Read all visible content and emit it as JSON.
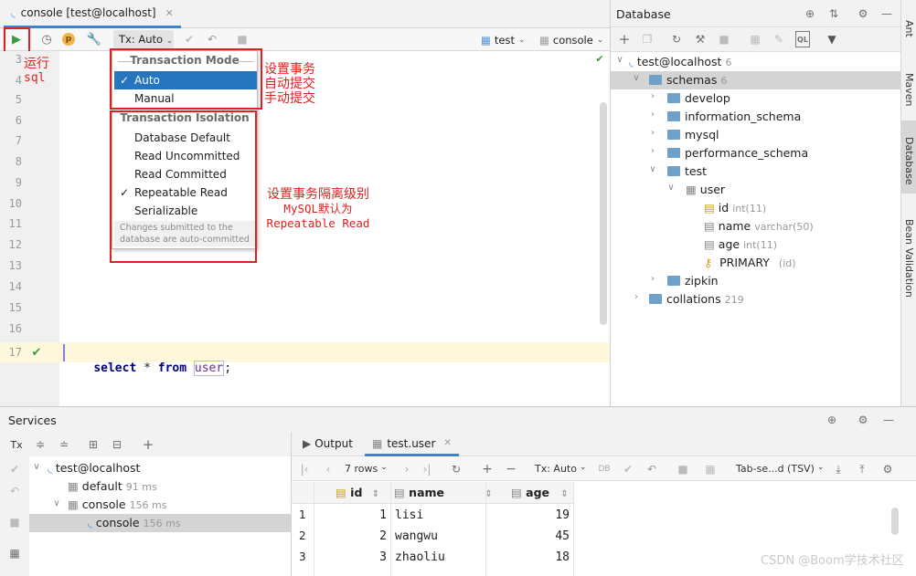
{
  "editor": {
    "tab_title": "console [test@localhost]",
    "tx_mode_label": "Tx: Auto",
    "datasource_label": "test",
    "session_label": "console",
    "line_numbers": [
      "3",
      "4",
      "5",
      "6",
      "7",
      "8",
      "9",
      "10",
      "11",
      "12",
      "13",
      "14",
      "15",
      "16",
      "17"
    ],
    "sql": {
      "kw1": "select",
      "star": " * ",
      "kw2": "from",
      "ident": "user",
      "semi": ";"
    }
  },
  "tx_popup": {
    "mode_header": "Transaction Mode",
    "mode_items": [
      {
        "label": "Auto",
        "checked": true
      },
      {
        "label": "Manual",
        "checked": false
      }
    ],
    "isolation_header": "Transaction Isolation",
    "isolation_items": [
      {
        "label": "Database Default",
        "checked": false
      },
      {
        "label": "Read Uncommitted",
        "checked": false
      },
      {
        "label": "Read Committed",
        "checked": false
      },
      {
        "label": "Repeatable Read",
        "checked": true
      },
      {
        "label": "Serializable",
        "checked": false
      }
    ],
    "note_line1": "Changes submitted to the",
    "note_line2": "database are auto-committed"
  },
  "annotations": {
    "run_line1": "运行",
    "run_line2": "sql",
    "tx_line1": "设置事务",
    "tx_line2": "自动提交",
    "tx_line3": "手动提交",
    "iso_line1": "设置事务隔离级别",
    "iso_line2": "MySQL默认为",
    "iso_line3": "Repeatable Read"
  },
  "database": {
    "panel_title": "Database",
    "tree": {
      "root": "test@localhost",
      "root_count": "6",
      "schemas": "schemas",
      "schemas_count": "6",
      "develop": "develop",
      "information_schema": "information_schema",
      "mysql": "mysql",
      "performance_schema": "performance_schema",
      "test": "test",
      "user": "user",
      "col_id": "id",
      "col_id_type": "int(11)",
      "col_name": "name",
      "col_name_type": "varchar(50)",
      "col_age": "age",
      "col_age_type": "int(11)",
      "primary": "PRIMARY",
      "primary_cols": "(id)",
      "zipkin": "zipkin",
      "collations": "collations",
      "collations_count": "219"
    }
  },
  "side_tabs": [
    "Ant",
    "Maven",
    "Database",
    "Bean Validation"
  ],
  "services": {
    "title": "Services",
    "tx_icon_label": "Tx",
    "tree": {
      "root": "test@localhost",
      "default": "default",
      "default_time": "91 ms",
      "console": "console",
      "console_time": "156 ms",
      "console_child": "console",
      "console_child_time": "156 ms"
    },
    "tabs": {
      "output": "Output",
      "result": "test.user"
    },
    "result_toolbar": {
      "rows": "7 rows",
      "tx": "Tx: Auto",
      "export": "Tab-se...d (TSV)"
    },
    "grid": {
      "columns": [
        "id",
        "name",
        "age"
      ],
      "rows": [
        {
          "n": "1",
          "id": "1",
          "name": "lisi",
          "age": "19"
        },
        {
          "n": "2",
          "id": "2",
          "name": "wangwu",
          "age": "45"
        },
        {
          "n": "3",
          "id": "3",
          "name": "zhaoliu",
          "age": "18"
        }
      ]
    }
  },
  "watermark": "CSDN @Boom学技术社区"
}
